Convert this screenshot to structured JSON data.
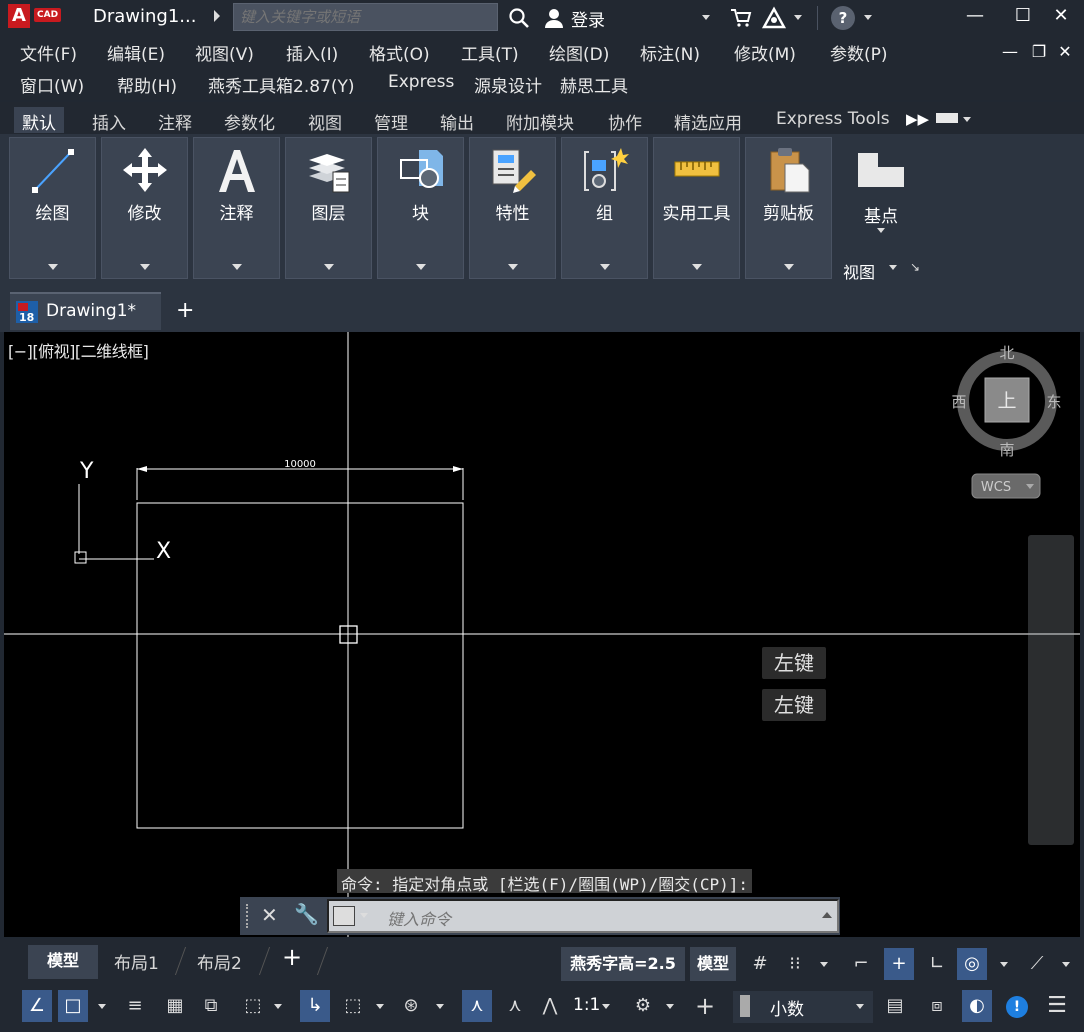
{
  "titlebar": {
    "logo_letter": "A",
    "logo_badge": "CAD",
    "doc_title": "Drawing1...",
    "search_placeholder": "键入关键字或短语",
    "login_label": "登录",
    "help_symbol": "?",
    "minimize": "—",
    "maximize": "☐",
    "close": "✕"
  },
  "menubar": {
    "row1": [
      "文件(F)",
      "编辑(E)",
      "视图(V)",
      "插入(I)",
      "格式(O)",
      "工具(T)",
      "绘图(D)",
      "标注(N)",
      "修改(M)",
      "参数(P)"
    ],
    "row2": [
      "窗口(W)",
      "帮助(H)",
      "燕秀工具箱2.87(Y)",
      "Express",
      "源泉设计",
      "赫思工具"
    ],
    "doc_min": "—",
    "doc_restore": "❐",
    "doc_close": "✕"
  },
  "ribbon_tabs": [
    "默认",
    "插入",
    "注释",
    "参数化",
    "视图",
    "管理",
    "输出",
    "附加模块",
    "协作",
    "精选应用",
    "Express Tools"
  ],
  "ribbon_panels": [
    "绘图",
    "修改",
    "注释",
    "图层",
    "块",
    "特性",
    "组",
    "实用工具",
    "剪贴板"
  ],
  "basepoint": {
    "label": "基点",
    "view_label": "视图"
  },
  "file_tab": {
    "label": "Drawing1*",
    "icon_text": "18",
    "new_tab": "+"
  },
  "viewport": {
    "label": "[−][俯视][二维线框]",
    "dimension_text": "10000",
    "ucs_x": "X",
    "ucs_y": "Y",
    "viewcube": {
      "north": "北",
      "south": "南",
      "east": "东",
      "west": "西",
      "top": "上",
      "wcs": "WCS"
    },
    "hints": [
      "左键",
      "左键"
    ]
  },
  "command": {
    "history": "命令: 指定对角点或 [栏选(F)/圈围(WP)/圈交(CP)]:",
    "placeholder": "键入命令"
  },
  "layout_tabs": [
    "模型",
    "布局1",
    "布局2"
  ],
  "layout_add": "+",
  "status": {
    "text_height": "燕秀字高=2.5",
    "model": "模型",
    "annotation_scale": "1:1",
    "units": "小数"
  },
  "colors": {
    "accent": "#3a5a8a",
    "canvas": "#000000",
    "chrome": "#222831",
    "panel": "#3b4452",
    "logo_red": "#c81a1f"
  },
  "icons": [
    "search-icon",
    "user-icon",
    "cart-icon",
    "a360-icon",
    "help-icon",
    "line-icon",
    "move-icon",
    "text-a-icon",
    "layers-icon",
    "block-icon",
    "properties-icon",
    "group-icon",
    "ruler-icon",
    "clipboard-icon",
    "basepoint-icon",
    "grid-icon",
    "snap-icon",
    "ortho-icon",
    "polar-icon",
    "gear-icon",
    "menu-icon"
  ]
}
